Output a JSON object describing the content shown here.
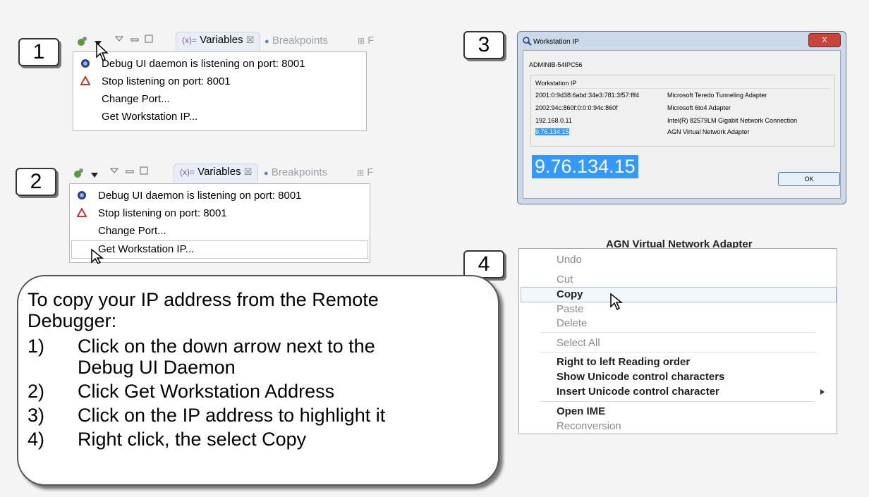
{
  "steps": [
    "1",
    "2",
    "3",
    "4"
  ],
  "eclipse": {
    "tab_active": "Variables",
    "tab_inactive": "Breakpoints",
    "tab_more": "F",
    "menu": [
      {
        "label": "Debug UI daemon is listening on port: 8001",
        "icon": "daemon-icon"
      },
      {
        "label": "Stop listening on port: 8001",
        "icon": "stop-icon"
      },
      {
        "label": "Change Port...",
        "icon": ""
      },
      {
        "label": "Get Workstation IP...",
        "icon": ""
      }
    ],
    "icons": {
      "x_glyph": "☒",
      "dot_glyph": "●",
      "grid_glyph": "⊞"
    }
  },
  "workstation": {
    "title": "Workstation IP",
    "close": "X",
    "hostname": "ADMINIB-54IPC56",
    "group_label": "Workstation IP",
    "rows": [
      {
        "ip": "2001:0:9d38:6abd:34e3:781:3f57:fff4",
        "adapter": "Microsoft Teredo Tunneling Adapter"
      },
      {
        "ip": "2002:94c:860f:0:0:0:94c:860f",
        "adapter": "Microsoft 6to4 Adapter"
      },
      {
        "ip": "192.168.0.11",
        "adapter": "Intel(R) 82579LM Gigabit Network Connection"
      },
      {
        "ip": "9.76.134.15",
        "adapter": "AGN Virtual Network Adapter"
      }
    ],
    "big_ip": "9.76.134.15",
    "ok": "OK"
  },
  "context": {
    "adapter_caption": "AGN Virtual Network Adapter",
    "items": {
      "undo": "Undo",
      "cut": "Cut",
      "copy": "Copy",
      "paste": "Paste",
      "delete": "Delete",
      "select_all": "Select All",
      "rtl": "Right to left Reading order",
      "show_unicode": "Show Unicode control characters",
      "insert_unicode": "Insert Unicode control character",
      "open_ime": "Open IME",
      "reconversion": "Reconversion"
    }
  },
  "instructions": {
    "line1": "To copy your IP address from the Remote",
    "line2": "Debugger:",
    "n1": "1)",
    "s1a": "Click on the down arrow next to the",
    "s1b": "Debug UI Daemon",
    "n2": "2)",
    "s2": "Click Get Workstation Address",
    "n3": "3)",
    "s3": "Click on the IP address to highlight it",
    "n4": "4)",
    "s4": "Right click, the select Copy"
  }
}
